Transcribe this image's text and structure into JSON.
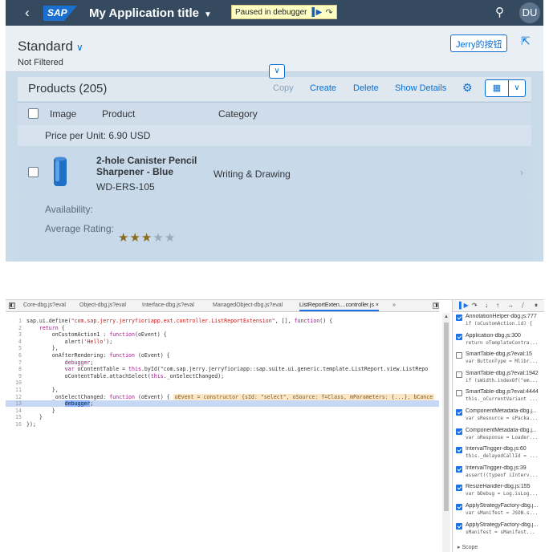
{
  "shell": {
    "back_icon": "chevron-left-icon",
    "logo": "SAP",
    "app_title": "My Application title",
    "paused_text": "Paused in debugger",
    "avatar_initials": "DU"
  },
  "header": {
    "variant": "Standard",
    "filter_status": "Not Filtered",
    "jerry_button": "Jerry的按钮"
  },
  "table": {
    "title": "Products (205)",
    "actions": {
      "copy": "Copy",
      "create": "Create",
      "delete": "Delete",
      "show_details": "Show Details"
    },
    "columns": {
      "image": "Image",
      "product": "Product",
      "category": "Category"
    },
    "group_header": "Price per Unit: 6.90  USD",
    "row": {
      "name": "2-hole Canister Pencil Sharpener - Blue",
      "id": "WD-ERS-105",
      "category": "Writing & Drawing"
    },
    "availability_label": "Availability:",
    "rating_label": "Average Rating:",
    "rating": 3,
    "rating_max": 5
  },
  "devtools": {
    "tabs": [
      "Core-dbg.js?eval",
      "Object-dbg.js?eval",
      "Interface-dbg.js?eval",
      "ManagedObject-dbg.js?eval",
      "ListReportExten....controller.js ×"
    ],
    "more": "»",
    "code_lines": [
      {
        "n": "1",
        "text": "sap.ui.define(\"com.sap.jerry.jerryfioriapp.ext.controller.ListReportExtension\", [], function() {"
      },
      {
        "n": "2",
        "text": "    return {"
      },
      {
        "n": "3",
        "text": "        onCustomAction1 : function(oEvent) {"
      },
      {
        "n": "4",
        "text": "            alert('Hello');"
      },
      {
        "n": "5",
        "text": "        },"
      },
      {
        "n": "6",
        "text": "        onAfterRendering: function (oEvent) {"
      },
      {
        "n": "7",
        "text": "            debugger;"
      },
      {
        "n": "8",
        "text": "            var oContentTable = this.byId(\"com.sap.jerry.jerryfioriapp::sap.suite.ui.generic.template.ListReport.view.ListRepo"
      },
      {
        "n": "9",
        "text": "            oContentTable.attachSelect(this._onSelectChanged);"
      },
      {
        "n": "10",
        "text": ""
      },
      {
        "n": "11",
        "text": "        },"
      },
      {
        "n": "12",
        "text": "        _onSelectChanged: function (oEvent) {"
      },
      {
        "n": "13",
        "text": "            debugger;"
      },
      {
        "n": "14",
        "text": "        }"
      },
      {
        "n": "15",
        "text": "    }"
      },
      {
        "n": "16",
        "text": "});"
      }
    ],
    "inline_value": "oEvent = constructor {sId: \"select\", oSource: f=Class, mParameters: {...}, bCance",
    "call_stack": [
      {
        "name": "AnnotationHelper-dbg.js:777",
        "code": "if (oCustomAction.id) {",
        "checked": true
      },
      {
        "name": "Application-dbg.js:300",
        "code": "return oTemplateContra...",
        "checked": true
      },
      {
        "name": "SmartTable-dbg.js?eval:15",
        "code": "var ButtonType = Mlibr...",
        "checked": false
      },
      {
        "name": "SmartTable-dbg.js?eval:1942",
        "code": "if (sWidth.indexOf(\"em...",
        "checked": false
      },
      {
        "name": "SmartTable-dbg.js?eval:4444",
        "code": "this._oCurrentVariant ...",
        "checked": false
      },
      {
        "name": "ComponentMetadata-dbg.j...",
        "code": "var sResource = sPacka...",
        "checked": true
      },
      {
        "name": "ComponentMetadata-dbg.j...",
        "code": "var oResponse = Loader...",
        "checked": true
      },
      {
        "name": "IntervalTrigger-dbg.js:60",
        "code": "this._delayedCallId = ...",
        "checked": true
      },
      {
        "name": "IntervalTrigger-dbg.js:39",
        "code": "assert((typeof iInterv...",
        "checked": true
      },
      {
        "name": "ResizeHandler-dbg.js:155",
        "code": "var bDebug = Log.isLog...",
        "checked": true
      },
      {
        "name": "ApplyStrategyFactory-dbg.j...",
        "code": "var sManifest = JSON.s...",
        "checked": true
      },
      {
        "name": "ApplyStrategyFactory-dbg.j...",
        "code": "sManifest = sManifest...",
        "checked": true
      }
    ],
    "scope_label": "▸ Scope"
  }
}
